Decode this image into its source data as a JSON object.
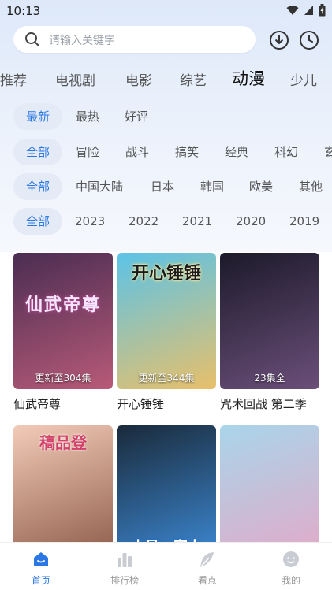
{
  "status_bar": {
    "time": "10:13"
  },
  "search": {
    "placeholder": "请输入关键字"
  },
  "category_tabs": [
    {
      "label": "推荐"
    },
    {
      "label": "电视剧"
    },
    {
      "label": "电影"
    },
    {
      "label": "综艺"
    },
    {
      "label": "动漫",
      "active": true
    },
    {
      "label": "少儿"
    }
  ],
  "filters": {
    "sort": [
      "最新",
      "最热",
      "好评"
    ],
    "genre": [
      "全部",
      "冒险",
      "战斗",
      "搞笑",
      "经典",
      "科幻",
      "玄"
    ],
    "region": [
      "全部",
      "中国大陆",
      "日本",
      "韩国",
      "欧美",
      "其他"
    ],
    "year": [
      "全部",
      "2023",
      "2022",
      "2021",
      "2020",
      "2019"
    ]
  },
  "cards": [
    {
      "title": "仙武帝尊",
      "badge": "更新至304集",
      "cover_text": "仙武帝尊",
      "colors": [
        "#4a2d52",
        "#b85a78"
      ]
    },
    {
      "title": "开心锤锤",
      "badge": "更新至344集",
      "cover_text": "开心锤锤",
      "colors": [
        "#5bc3e8",
        "#e8c06a"
      ]
    },
    {
      "title": "咒术回战 第二季",
      "badge": "23集全",
      "cover_text": "",
      "colors": [
        "#1c1a2a",
        "#6b4f7a"
      ]
    },
    {
      "title": "",
      "badge": "",
      "cover_text": "稿品登",
      "colors": [
        "#f2cbb8",
        "#8c5a48"
      ]
    },
    {
      "title": "",
      "badge": "",
      "cover_text": "小号一家人",
      "colors": [
        "#1a2a3a",
        "#3d8ad6"
      ]
    },
    {
      "title": "",
      "badge": "",
      "cover_text": "",
      "colors": [
        "#a9d5ea",
        "#e3a9c8"
      ]
    }
  ],
  "bottom_nav": [
    {
      "label": "首页",
      "icon": "home-icon",
      "active": true
    },
    {
      "label": "排行榜",
      "icon": "ranking-icon"
    },
    {
      "label": "看点",
      "icon": "feather-icon"
    },
    {
      "label": "我的",
      "icon": "profile-icon"
    }
  ],
  "colors": {
    "accent": "#2b78e4",
    "chip_bg": "#e4ebf6"
  }
}
